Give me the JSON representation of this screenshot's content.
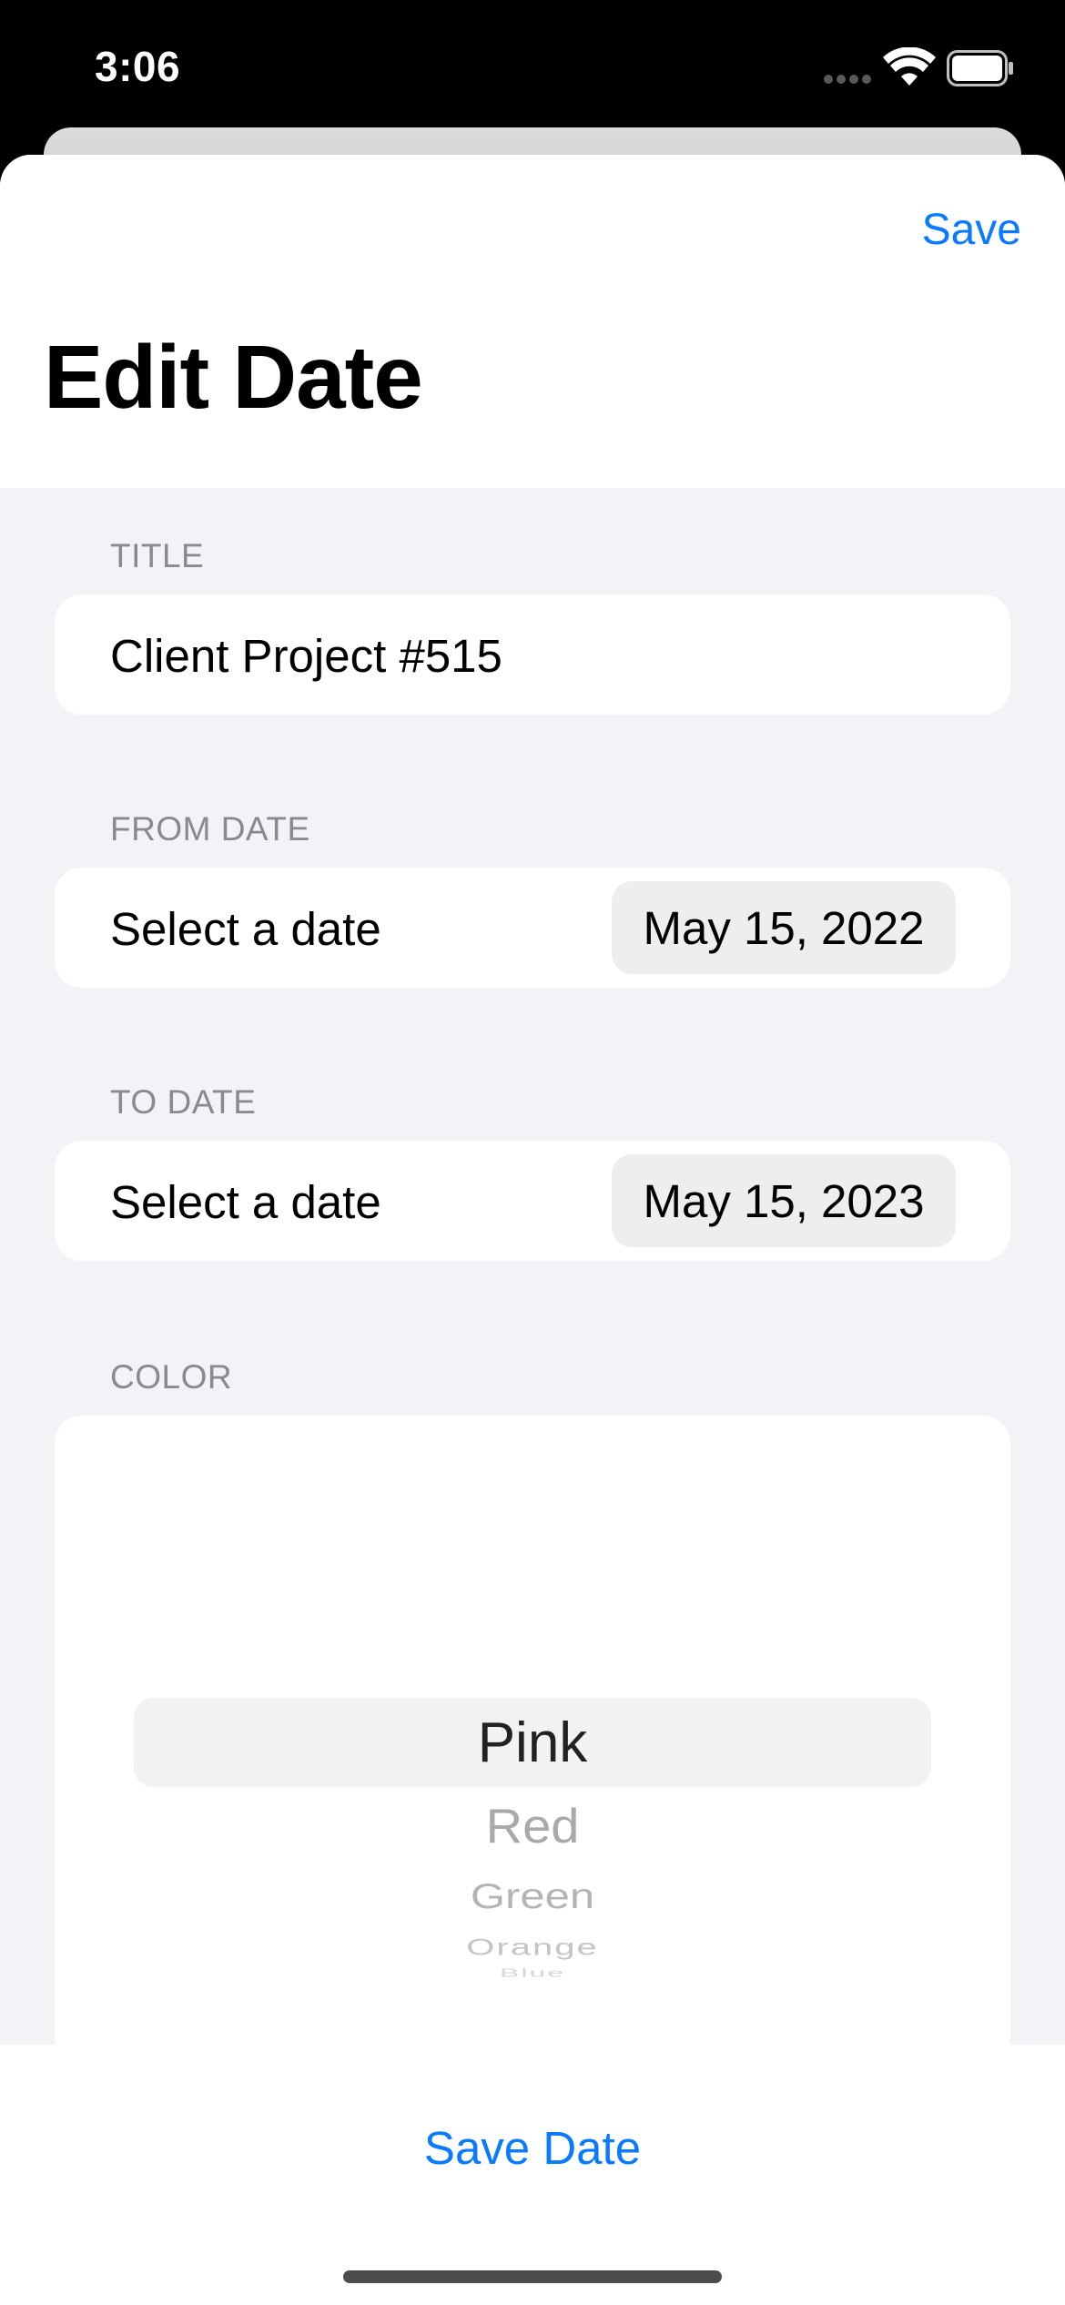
{
  "status_bar": {
    "time": "3:06",
    "icons": [
      "signal-icon",
      "wifi-icon",
      "battery-icon"
    ]
  },
  "header": {
    "save_label": "Save",
    "title": "Edit Date"
  },
  "sections": {
    "title": {
      "header": "TITLE",
      "value": "Client Project #515"
    },
    "from_date": {
      "header": "FROM DATE",
      "label": "Select a date",
      "value": "May 15, 2022"
    },
    "to_date": {
      "header": "TO DATE",
      "label": "Select a date",
      "value": "May 15, 2023"
    },
    "color": {
      "header": "COLOR",
      "options": [
        "Pink",
        "Red",
        "Green",
        "Orange",
        "Blue"
      ],
      "selected": "Pink"
    }
  },
  "bottom": {
    "save_date_label": "Save Date"
  },
  "colors": {
    "accent": "#0A7AFF",
    "grouped_background": "#F2F2F7",
    "secondary_label": "#8A8A8E"
  }
}
